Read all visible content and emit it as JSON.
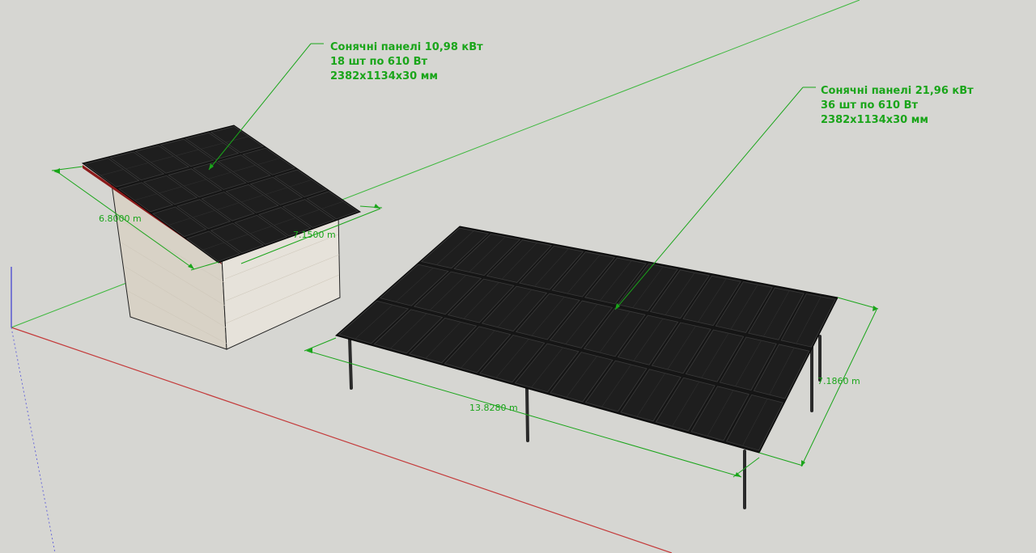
{
  "colors": {
    "background": "#d6d6d2",
    "annotation": "#1aa51a",
    "axis_red": "#c43a3a",
    "axis_green": "#3cb83c",
    "axis_blue": "#3a3ad0",
    "panel": "#151515",
    "wall": "#e0dbd2",
    "roof_edge": "#8b1a1a"
  },
  "house_label": {
    "line1": "Сонячні панелі 10,98 кВт",
    "line2": "18 шт по 610 Вт",
    "line3": "2382x1134x30 мм"
  },
  "ground_label": {
    "line1": "Сонячні панелі 21,96 кВт",
    "line2": "36 шт по 610 Вт",
    "line3": "2382x1134x30 мм"
  },
  "dimensions": {
    "house_depth": "6.8000 m",
    "house_width": "7.1500 m",
    "array_length": "13.8280 m",
    "array_width": "7.1860 m"
  }
}
